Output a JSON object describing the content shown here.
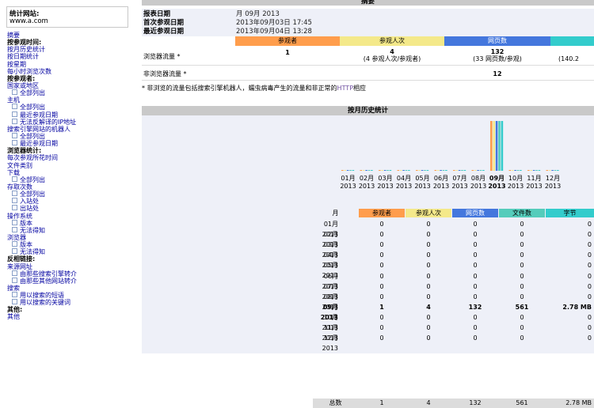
{
  "nav": {
    "site_caption": "统计网站:",
    "site_url": "www.a.com",
    "items": [
      {
        "type": "link",
        "label": "摘要"
      },
      {
        "type": "head",
        "label": "按参观时间:"
      },
      {
        "type": "link",
        "label": "按月历史统计"
      },
      {
        "type": "link",
        "label": "按日期统计"
      },
      {
        "type": "link",
        "label": "按星期"
      },
      {
        "type": "link",
        "label": "每小时浏览次数"
      },
      {
        "type": "head",
        "label": "按参观者:"
      },
      {
        "type": "link",
        "label": "国家或地区"
      },
      {
        "type": "sub",
        "label": "全部列出"
      },
      {
        "type": "link",
        "label": "主机"
      },
      {
        "type": "sub",
        "label": "全部列出"
      },
      {
        "type": "sub",
        "label": "最近参观日期"
      },
      {
        "type": "sub",
        "label": "无法反解译的IP地址"
      },
      {
        "type": "link",
        "label": "搜索引擎网站的机器人"
      },
      {
        "type": "sub",
        "label": "全部列出"
      },
      {
        "type": "sub",
        "label": "最近参观日期"
      },
      {
        "type": "head",
        "label": "浏览器统计:"
      },
      {
        "type": "link",
        "label": "每次参观所花时间"
      },
      {
        "type": "link",
        "label": "文件类别"
      },
      {
        "type": "link",
        "label": "下载"
      },
      {
        "type": "sub",
        "label": "全部列出"
      },
      {
        "type": "link",
        "label": "存取次数"
      },
      {
        "type": "sub",
        "label": "全部列出"
      },
      {
        "type": "sub",
        "label": "入站处"
      },
      {
        "type": "sub",
        "label": "出站处"
      },
      {
        "type": "link",
        "label": "操作系统"
      },
      {
        "type": "sub",
        "label": "版本"
      },
      {
        "type": "sub",
        "label": "无法得知"
      },
      {
        "type": "link",
        "label": "浏览器"
      },
      {
        "type": "sub",
        "label": "版本"
      },
      {
        "type": "sub",
        "label": "无法得知"
      },
      {
        "type": "head",
        "label": "反相链接:"
      },
      {
        "type": "link",
        "label": "来源网址"
      },
      {
        "type": "sub",
        "label": "由那些搜索引擎转介"
      },
      {
        "type": "sub",
        "label": "由那些其他网站转介"
      },
      {
        "type": "link",
        "label": "搜索"
      },
      {
        "type": "sub",
        "label": "用以搜索的短语"
      },
      {
        "type": "sub",
        "label": "用以搜索的关键词"
      },
      {
        "type": "head",
        "label": "其他:"
      },
      {
        "type": "link",
        "label": "其他"
      }
    ]
  },
  "summary": {
    "title": "摘要",
    "report_period_label": "报表日期",
    "report_period_value": "月  09月  2013",
    "first_visit_label": "首次参观日期",
    "first_visit_value": "2013年09月03日  17:45",
    "last_visit_label": "最近参观日期",
    "last_visit_value": "2013年09月04日  13:28",
    "col_visitors": "参观者",
    "col_visits": "参观人次",
    "col_pages": "网页数",
    "viewed_label": "浏览器流量 *",
    "viewed_visitors": "1",
    "viewed_visits": "4",
    "viewed_visits_sub": "(4 参观人次/参观者)",
    "viewed_pages": "132",
    "viewed_pages_sub": "(33 网页数/参观)",
    "viewed_files_sub": "(140.2",
    "notviewed_label": "非浏览器流量 *",
    "notviewed_pages": "12"
  },
  "note": {
    "text_before": "* 非浏览的流量包括搜索引擎机器人，蠕虫病毒产生的流量和非正常的",
    "text_accent": "HTTP",
    "text_after": "相应"
  },
  "monthly": {
    "title": "按月历史统计",
    "col_month": "月",
    "col_visitors": "参观者",
    "col_visits": "参观人次",
    "col_pages": "网页数",
    "col_files": "文件数",
    "col_bytes": "字节",
    "total_label": "总数",
    "total_visitors": "1",
    "total_visits": "4",
    "total_pages": "132",
    "total_files": "561",
    "total_bytes": "2.78 MB"
  },
  "colors": {
    "visitors": "#ff9d4c",
    "visits": "#f4e98a",
    "pages": "#4477dd",
    "files": "#55ccbb",
    "bytes": "#33cccc",
    "panel": "#eef0f8",
    "titlebar": "#c9c9c9"
  },
  "chart_data": {
    "type": "bar",
    "categories": [
      "01月 2013",
      "02月 2013",
      "03月 2013",
      "04月 2013",
      "05月 2013",
      "06月 2013",
      "07月 2013",
      "08月 2013",
      "09月 2013",
      "10月 2013",
      "11月 2013",
      "12月 2013"
    ],
    "month_labels": [
      "01月",
      "02月",
      "03月",
      "04月",
      "05月",
      "06月",
      "07月",
      "08月",
      "09月",
      "10月",
      "11月",
      "12月"
    ],
    "year_label": "2013",
    "highlight_index": 8,
    "series": [
      {
        "name": "参观者",
        "values": [
          0,
          0,
          0,
          0,
          0,
          0,
          0,
          0,
          1,
          0,
          0,
          0
        ]
      },
      {
        "name": "参观人次",
        "values": [
          0,
          0,
          0,
          0,
          0,
          0,
          0,
          0,
          4,
          0,
          0,
          0
        ]
      },
      {
        "name": "网页数",
        "values": [
          0,
          0,
          0,
          0,
          0,
          0,
          0,
          0,
          132,
          0,
          0,
          0
        ]
      },
      {
        "name": "文件数",
        "values": [
          0,
          0,
          0,
          0,
          0,
          0,
          0,
          0,
          561,
          0,
          0,
          0
        ]
      },
      {
        "name": "字节",
        "values": [
          "0",
          "0",
          "0",
          "0",
          "0",
          "0",
          "0",
          "0",
          "2.78 MB",
          "0",
          "0",
          "0"
        ]
      }
    ]
  }
}
